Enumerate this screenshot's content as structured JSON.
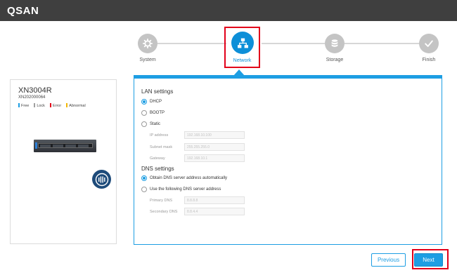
{
  "header": {
    "logo": "QSAN"
  },
  "steps": [
    {
      "label": "System",
      "icon": "gear-icon",
      "state": "done"
    },
    {
      "label": "Network",
      "icon": "network-icon",
      "state": "active"
    },
    {
      "label": "Storage",
      "icon": "database-icon",
      "state": "pending"
    },
    {
      "label": "Finish",
      "icon": "checkmark-icon",
      "state": "pending"
    }
  ],
  "device": {
    "model": "XN3004R",
    "serial": "XN202000064",
    "legend": [
      {
        "label": "Free",
        "color": "#1d9ee3"
      },
      {
        "label": "Lock",
        "color": "#a0a0a0"
      },
      {
        "label": "Error",
        "color": "#e2001a"
      },
      {
        "label": "Abnormal",
        "color": "#f2b700"
      }
    ]
  },
  "lan": {
    "title": "LAN settings",
    "options": [
      "DHCP",
      "BOOTP",
      "Static"
    ],
    "selected": "DHCP",
    "ip_label": "IP address",
    "ip_value": "192.168.10.100",
    "mask_label": "Subnet mask",
    "mask_value": "255.255.255.0",
    "gateway_label": "Gateway",
    "gateway_value": "192.168.10.1"
  },
  "dns": {
    "title": "DNS settings",
    "auto_label": "Obtain DNS server address automatically",
    "manual_label": "Use the following DNS server address",
    "selected": "auto",
    "primary_label": "Primary DNS",
    "primary_value": "8.8.8.8",
    "secondary_label": "Secondary DNS",
    "secondary_value": "8.8.4.4"
  },
  "buttons": {
    "previous": "Previous",
    "next": "Next"
  },
  "colors": {
    "accent": "#1d9ee3",
    "highlight": "#e2001a",
    "topbar": "#3f3f3f"
  }
}
